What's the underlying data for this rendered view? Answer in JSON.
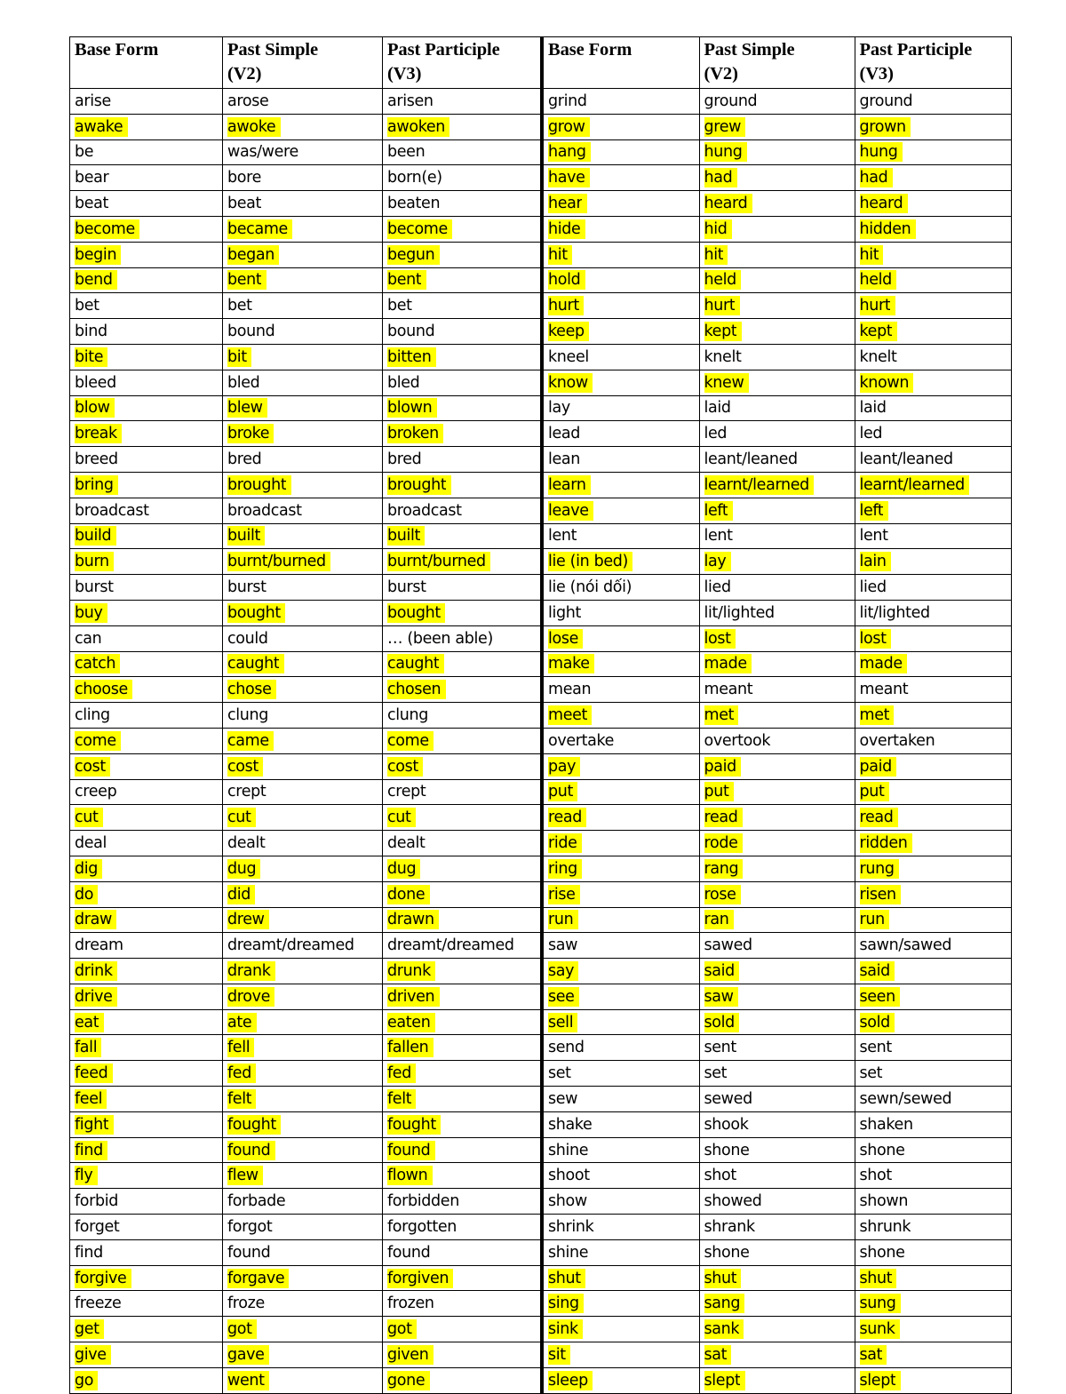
{
  "document": {
    "kind": "irregular-verbs-table",
    "highlight_color": "#FFFF00",
    "text_color": "#000000",
    "border_color": "#000000"
  },
  "headers": {
    "base_form": "Base Form",
    "past_simple_line1": "Past Simple",
    "past_simple_line2": "(V2)",
    "past_participle_line1": "Past Participle",
    "past_participle_line2": "(V3)"
  },
  "left_table": {
    "columns": [
      "Base Form",
      "Past Simple (V2)",
      "Past Participle (V3)"
    ],
    "rows": [
      {
        "v1": "arise",
        "v2": "arose",
        "v3": "arisen",
        "hl": false
      },
      {
        "v1": "awake",
        "v2": "awoke",
        "v3": "awoken",
        "hl": true
      },
      {
        "v1": "be",
        "v2": "was/were",
        "v3": "been",
        "hl": false
      },
      {
        "v1": "bear",
        "v2": "bore",
        "v3": "born(e)",
        "hl": false
      },
      {
        "v1": "beat",
        "v2": "beat",
        "v3": "beaten",
        "hl": false
      },
      {
        "v1": "become",
        "v2": "became",
        "v3": "become",
        "hl": true
      },
      {
        "v1": "begin",
        "v2": "began",
        "v3": "begun",
        "hl": true
      },
      {
        "v1": "bend",
        "v2": "bent",
        "v3": "bent",
        "hl": true
      },
      {
        "v1": "bet",
        "v2": "bet",
        "v3": "bet",
        "hl": false
      },
      {
        "v1": "bind",
        "v2": "bound",
        "v3": "bound",
        "hl": false
      },
      {
        "v1": "bite",
        "v2": "bit",
        "v3": "bitten",
        "hl": true
      },
      {
        "v1": "bleed",
        "v2": "bled",
        "v3": "bled",
        "hl": false
      },
      {
        "v1": "blow",
        "v2": "blew",
        "v3": "blown",
        "hl": true
      },
      {
        "v1": "break",
        "v2": "broke",
        "v3": "broken",
        "hl": true
      },
      {
        "v1": "breed",
        "v2": "bred",
        "v3": "bred",
        "hl": false
      },
      {
        "v1": "bring",
        "v2": "brought",
        "v3": "brought",
        "hl": true
      },
      {
        "v1": "broadcast",
        "v2": "broadcast",
        "v3": "broadcast",
        "hl": false
      },
      {
        "v1": "build",
        "v2": "built",
        "v3": "built",
        "hl": true
      },
      {
        "v1": "burn",
        "v2": "burnt/burned",
        "v3": "burnt/burned",
        "hl": true
      },
      {
        "v1": "burst",
        "v2": "burst",
        "v3": "burst",
        "hl": false
      },
      {
        "v1": "buy",
        "v2": "bought",
        "v3": "bought",
        "hl": true
      },
      {
        "v1": "can",
        "v2": "could",
        "v3": "… (been able)",
        "hl": false
      },
      {
        "v1": "catch",
        "v2": "caught",
        "v3": "caught",
        "hl": true
      },
      {
        "v1": "choose",
        "v2": "chose",
        "v3": "chosen",
        "hl": true
      },
      {
        "v1": "cling",
        "v2": "clung",
        "v3": "clung",
        "hl": false
      },
      {
        "v1": "come",
        "v2": "came",
        "v3": "come",
        "hl": true
      },
      {
        "v1": "cost",
        "v2": "cost",
        "v3": "cost",
        "hl": true
      },
      {
        "v1": "creep",
        "v2": "crept",
        "v3": "crept",
        "hl": false
      },
      {
        "v1": "cut",
        "v2": "cut",
        "v3": "cut",
        "hl": true
      },
      {
        "v1": "deal",
        "v2": "dealt",
        "v3": "dealt",
        "hl": false
      },
      {
        "v1": "dig",
        "v2": "dug",
        "v3": "dug",
        "hl": true
      },
      {
        "v1": "do",
        "v2": "did",
        "v3": "done",
        "hl": true
      },
      {
        "v1": "draw",
        "v2": "drew",
        "v3": "drawn",
        "hl": true
      },
      {
        "v1": "dream",
        "v2": "dreamt/dreamed",
        "v3": "dreamt/dreamed",
        "hl": false
      },
      {
        "v1": "drink",
        "v2": "drank",
        "v3": "drunk",
        "hl": true
      },
      {
        "v1": "drive",
        "v2": "drove",
        "v3": "driven",
        "hl": true
      },
      {
        "v1": "eat",
        "v2": "ate",
        "v3": "eaten",
        "hl": true
      },
      {
        "v1": "fall",
        "v2": "fell",
        "v3": "fallen",
        "hl": true
      },
      {
        "v1": "feed",
        "v2": "fed",
        "v3": "fed",
        "hl": true
      },
      {
        "v1": "feel",
        "v2": "felt",
        "v3": "felt",
        "hl": true
      },
      {
        "v1": "fight",
        "v2": "fought",
        "v3": "fought",
        "hl": true
      },
      {
        "v1": "find",
        "v2": "found",
        "v3": "found",
        "hl": true
      },
      {
        "v1": "fly",
        "v2": "flew",
        "v3": "flown",
        "hl": true
      },
      {
        "v1": "forbid",
        "v2": "forbade",
        "v3": "forbidden",
        "hl": false
      },
      {
        "v1": "forget",
        "v2": "forgot",
        "v3": "forgotten",
        "hl": false
      },
      {
        "v1": "find",
        "v2": "found",
        "v3": "found",
        "hl": false
      },
      {
        "v1": "forgive",
        "v2": "forgave",
        "v3": "forgiven",
        "hl": true
      },
      {
        "v1": "freeze",
        "v2": "froze",
        "v3": "frozen",
        "hl": false
      },
      {
        "v1": "get",
        "v2": "got",
        "v3": "got",
        "hl": true
      },
      {
        "v1": "give",
        "v2": "gave",
        "v3": "given",
        "hl": true
      },
      {
        "v1": "go",
        "v2": "went",
        "v3": "gone",
        "hl": true
      }
    ]
  },
  "right_table": {
    "columns": [
      "Base Form",
      "Past Simple (V2)",
      "Past Participle (V3)"
    ],
    "rows": [
      {
        "v1": "grind",
        "v2": "ground",
        "v3": "ground",
        "hl": false
      },
      {
        "v1": "grow",
        "v2": "grew",
        "v3": "grown",
        "hl": true
      },
      {
        "v1": "hang",
        "v2": "hung",
        "v3": "hung",
        "hl": true
      },
      {
        "v1": "have",
        "v2": "had",
        "v3": "had",
        "hl": true
      },
      {
        "v1": "hear",
        "v2": "heard",
        "v3": "heard",
        "hl": true
      },
      {
        "v1": "hide",
        "v2": "hid",
        "v3": "hidden",
        "hl": true
      },
      {
        "v1": "hit",
        "v2": "hit",
        "v3": "hit",
        "hl": true
      },
      {
        "v1": "hold",
        "v2": "held",
        "v3": "held",
        "hl": true
      },
      {
        "v1": "hurt",
        "v2": "hurt",
        "v3": "hurt",
        "hl": true
      },
      {
        "v1": "keep",
        "v2": "kept",
        "v3": "kept",
        "hl": true
      },
      {
        "v1": "kneel",
        "v2": "knelt",
        "v3": "knelt",
        "hl": false
      },
      {
        "v1": "know",
        "v2": "knew",
        "v3": "known",
        "hl": true
      },
      {
        "v1": "lay",
        "v2": "laid",
        "v3": "laid",
        "hl": false
      },
      {
        "v1": "lead",
        "v2": "led",
        "v3": "led",
        "hl": false
      },
      {
        "v1": "lean",
        "v2": "leant/leaned",
        "v3": "leant/leaned",
        "hl": false
      },
      {
        "v1": "learn",
        "v2": "learnt/learned",
        "v3": "learnt/learned",
        "hl": true
      },
      {
        "v1": "leave",
        "v2": "left",
        "v3": "left",
        "hl": true
      },
      {
        "v1": "lent",
        "v2": "lent",
        "v3": "lent",
        "hl": false
      },
      {
        "v1": "lie (in bed)",
        "v2": "lay",
        "v3": "lain",
        "hl": true
      },
      {
        "v1": "lie (nói dối)",
        "v2": "lied",
        "v3": "lied",
        "hl": false
      },
      {
        "v1": "light",
        "v2": "lit/lighted",
        "v3": "lit/lighted",
        "hl": false
      },
      {
        "v1": "lose",
        "v2": "lost",
        "v3": "lost",
        "hl": true
      },
      {
        "v1": "make",
        "v2": "made",
        "v3": "made",
        "hl": true
      },
      {
        "v1": "mean",
        "v2": "meant",
        "v3": "meant",
        "hl": false
      },
      {
        "v1": "meet",
        "v2": "met",
        "v3": "met",
        "hl": true
      },
      {
        "v1": "overtake",
        "v2": "overtook",
        "v3": "overtaken",
        "hl": false
      },
      {
        "v1": "pay",
        "v2": "paid",
        "v3": "paid",
        "hl": true
      },
      {
        "v1": "put",
        "v2": "put",
        "v3": "put",
        "hl": true
      },
      {
        "v1": "read",
        "v2": "read",
        "v3": "read",
        "hl": true
      },
      {
        "v1": "ride",
        "v2": "rode",
        "v3": "ridden",
        "hl": true
      },
      {
        "v1": "ring",
        "v2": "rang",
        "v3": "rung",
        "hl": true
      },
      {
        "v1": "rise",
        "v2": "rose",
        "v3": "risen",
        "hl": true
      },
      {
        "v1": "run",
        "v2": "ran",
        "v3": "run",
        "hl": true
      },
      {
        "v1": "saw",
        "v2": "sawed",
        "v3": "sawn/sawed",
        "hl": false
      },
      {
        "v1": "say",
        "v2": "said",
        "v3": "said",
        "hl": true
      },
      {
        "v1": "see",
        "v2": "saw",
        "v3": "seen",
        "hl": true
      },
      {
        "v1": "sell",
        "v2": "sold",
        "v3": "sold",
        "hl": true
      },
      {
        "v1": "send",
        "v2": "sent",
        "v3": "sent",
        "hl": false
      },
      {
        "v1": "set",
        "v2": "set",
        "v3": "set",
        "hl": false
      },
      {
        "v1": "sew",
        "v2": "sewed",
        "v3": "sewn/sewed",
        "hl": false
      },
      {
        "v1": "shake",
        "v2": "shook",
        "v3": "shaken",
        "hl": false
      },
      {
        "v1": "shine",
        "v2": "shone",
        "v3": "shone",
        "hl": false
      },
      {
        "v1": "shoot",
        "v2": "shot",
        "v3": "shot",
        "hl": false
      },
      {
        "v1": "show",
        "v2": "showed",
        "v3": "shown",
        "hl": false
      },
      {
        "v1": "shrink",
        "v2": "shrank",
        "v3": "shrunk",
        "hl": false
      },
      {
        "v1": "shine",
        "v2": "shone",
        "v3": "shone",
        "hl": false
      },
      {
        "v1": "shut",
        "v2": "shut",
        "v3": "shut",
        "hl": true
      },
      {
        "v1": "sing",
        "v2": "sang",
        "v3": "sung",
        "hl": true
      },
      {
        "v1": "sink",
        "v2": "sank",
        "v3": "sunk",
        "hl": true
      },
      {
        "v1": "sit",
        "v2": "sat",
        "v3": "sat",
        "hl": true
      },
      {
        "v1": "sleep",
        "v2": "slept",
        "v3": "slept",
        "hl": true
      }
    ]
  }
}
